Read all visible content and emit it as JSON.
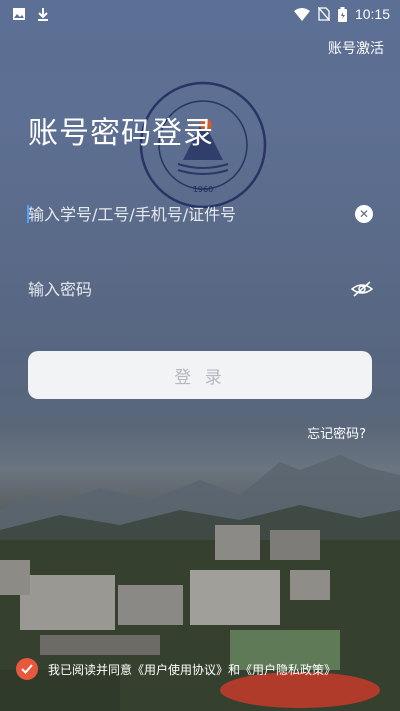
{
  "status": {
    "time": "10:15",
    "left_icons": [
      "image-icon",
      "download-icon"
    ],
    "right_icons": [
      "wifi-icon",
      "no-sim-icon",
      "battery-icon"
    ]
  },
  "header": {
    "activate_label": "账号激活"
  },
  "title": "账号密码登录",
  "form": {
    "username_placeholder": "输入学号/工号/手机号/证件号",
    "password_placeholder": "输入密码",
    "login_label": "登 录",
    "forgot_label": "忘记密码?"
  },
  "agreement": {
    "prefix": "我已阅读并同意",
    "terms_link": "《用户使用协议》",
    "and": "和",
    "privacy_link": "《用户隐私政策》"
  },
  "emblem": {
    "year": "1960"
  },
  "colors": {
    "accent": "#e8583c",
    "button_bg": "#f2f3f5",
    "button_text": "#b4b8bf"
  }
}
